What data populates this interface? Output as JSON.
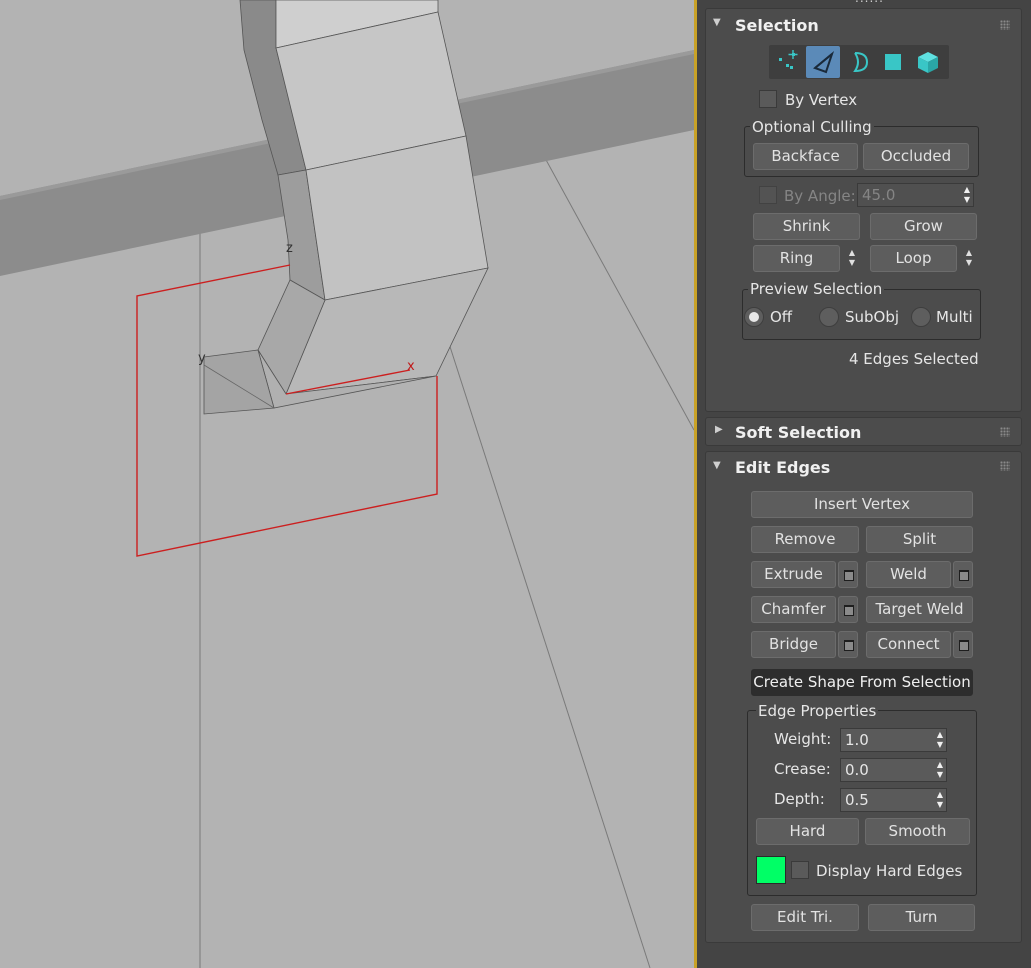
{
  "viewport": {
    "gizmo": {
      "z_label": "z",
      "y_label": "y",
      "x_label": "x"
    }
  },
  "panel": {
    "top_grip": "......",
    "selection": {
      "title": "Selection",
      "modes": [
        {
          "icon": "vertex-mode-icon"
        },
        {
          "icon": "edge-mode-icon",
          "active": true
        },
        {
          "icon": "border-mode-icon"
        },
        {
          "icon": "polygon-mode-icon"
        },
        {
          "icon": "element-mode-icon"
        }
      ],
      "by_vertex": "By Vertex",
      "optional_culling": {
        "label": "Optional Culling",
        "backface": "Backface",
        "occluded": "Occluded"
      },
      "by_angle": {
        "label": "By Angle:",
        "value": "45.0"
      },
      "shrink": "Shrink",
      "grow": "Grow",
      "ring": "Ring",
      "loop": "Loop",
      "preview": {
        "label": "Preview Selection",
        "options": [
          "Off",
          "SubObj",
          "Multi"
        ],
        "selected": "Off"
      },
      "status": "4 Edges Selected"
    },
    "soft_selection": {
      "title": "Soft Selection"
    },
    "edit_edges": {
      "title": "Edit Edges",
      "insert_vertex": "Insert Vertex",
      "remove": "Remove",
      "split": "Split",
      "extrude": "Extrude",
      "weld": "Weld",
      "chamfer": "Chamfer",
      "target_weld": "Target Weld",
      "bridge": "Bridge",
      "connect": "Connect",
      "create_shape": "Create Shape From Selection",
      "edge_properties": {
        "label": "Edge Properties",
        "weight_label": "Weight:",
        "weight": "1.0",
        "crease_label": "Crease:",
        "crease": "0.0",
        "depth_label": "Depth:",
        "depth": "0.5",
        "hard": "Hard",
        "smooth": "Smooth",
        "display_hard_edges": "Display Hard Edges",
        "hard_edge_color": "#00ff66"
      },
      "edit_tri": "Edit Tri.",
      "turn": "Turn"
    }
  }
}
